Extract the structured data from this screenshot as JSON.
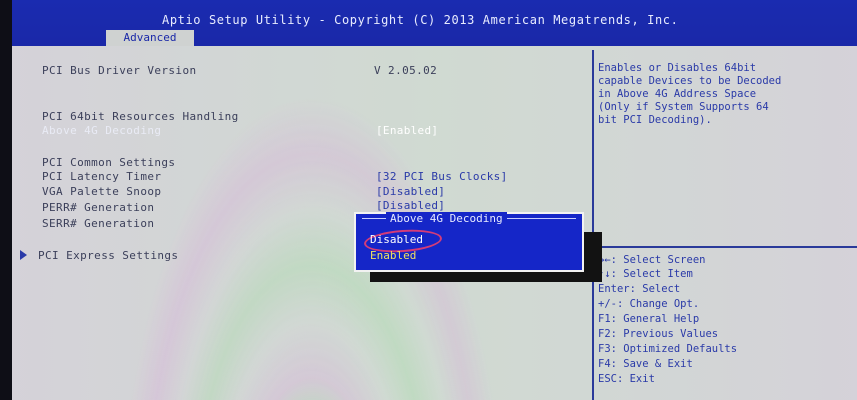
{
  "header": {
    "title": "Aptio Setup Utility - Copyright (C) 2013 American Megatrends, Inc.",
    "active_tab": "Advanced"
  },
  "settings": {
    "pci_bus_driver_version_label": "PCI Bus Driver Version",
    "pci_bus_driver_version_value": "V 2.05.02",
    "pci64_heading": "PCI 64bit Resources Handling",
    "above4g_label": "Above 4G Decoding",
    "above4g_value": "[Enabled]",
    "common_heading": "PCI Common Settings",
    "latency_label": "PCI Latency Timer",
    "latency_value": "[32 PCI Bus Clocks]",
    "vga_label": "VGA Palette Snoop",
    "vga_value": "[Disabled]",
    "perr_label": "PERR# Generation",
    "perr_value": "[Disabled]",
    "serr_label": "SERR# Generation",
    "express_label": "PCI Express Settings"
  },
  "help": {
    "description": [
      "Enables or Disables 64bit",
      "capable Devices to be Decoded",
      "in Above 4G Address Space",
      "(Only if System Supports 64",
      "bit PCI Decoding)."
    ],
    "keys": [
      "→←: Select Screen",
      "↑↓: Select Item",
      "Enter: Select",
      "+/-: Change Opt.",
      "F1: General Help",
      "F2: Previous Values",
      "F3: Optimized Defaults",
      "F4: Save & Exit",
      "ESC: Exit"
    ]
  },
  "popup": {
    "title": "Above 4G Decoding",
    "options": [
      "Disabled",
      "Enabled"
    ],
    "selected": "Enabled"
  }
}
